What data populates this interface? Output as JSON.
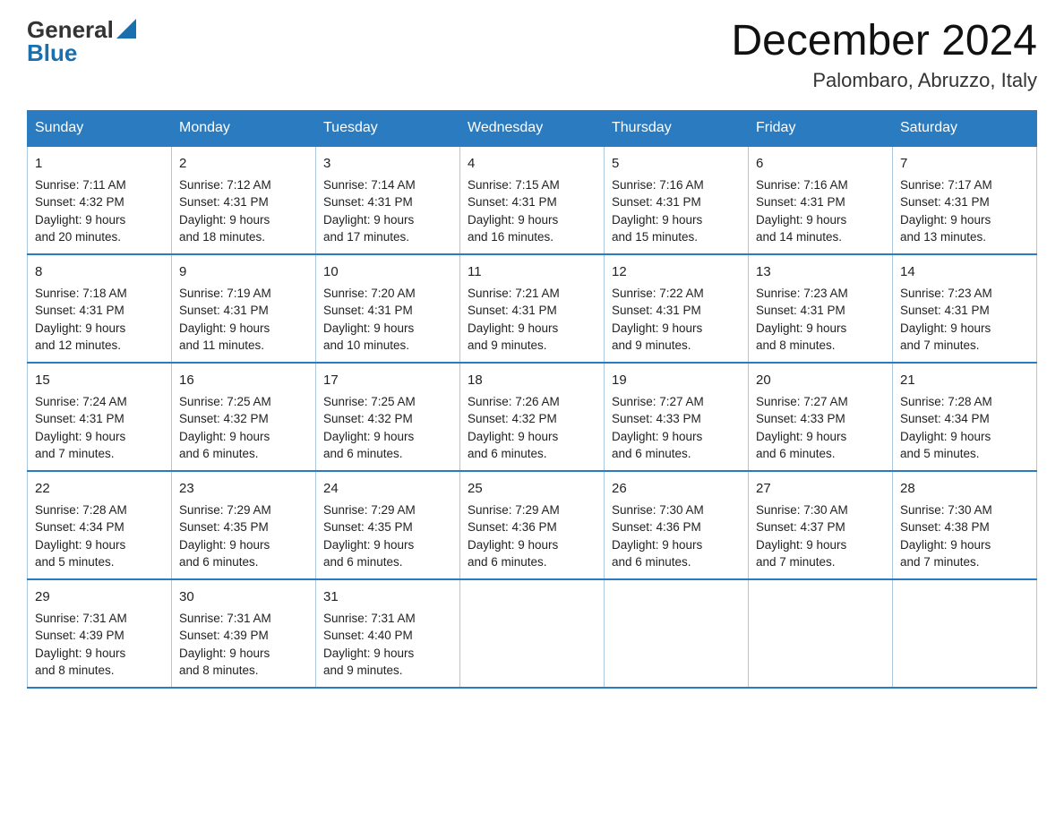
{
  "logo": {
    "general": "General",
    "blue": "Blue",
    "triangle": "▲"
  },
  "title": {
    "month": "December 2024",
    "location": "Palombaro, Abruzzo, Italy"
  },
  "headers": [
    "Sunday",
    "Monday",
    "Tuesday",
    "Wednesday",
    "Thursday",
    "Friday",
    "Saturday"
  ],
  "weeks": [
    [
      {
        "day": "1",
        "info": "Sunrise: 7:11 AM\nSunset: 4:32 PM\nDaylight: 9 hours\nand 20 minutes."
      },
      {
        "day": "2",
        "info": "Sunrise: 7:12 AM\nSunset: 4:31 PM\nDaylight: 9 hours\nand 18 minutes."
      },
      {
        "day": "3",
        "info": "Sunrise: 7:14 AM\nSunset: 4:31 PM\nDaylight: 9 hours\nand 17 minutes."
      },
      {
        "day": "4",
        "info": "Sunrise: 7:15 AM\nSunset: 4:31 PM\nDaylight: 9 hours\nand 16 minutes."
      },
      {
        "day": "5",
        "info": "Sunrise: 7:16 AM\nSunset: 4:31 PM\nDaylight: 9 hours\nand 15 minutes."
      },
      {
        "day": "6",
        "info": "Sunrise: 7:16 AM\nSunset: 4:31 PM\nDaylight: 9 hours\nand 14 minutes."
      },
      {
        "day": "7",
        "info": "Sunrise: 7:17 AM\nSunset: 4:31 PM\nDaylight: 9 hours\nand 13 minutes."
      }
    ],
    [
      {
        "day": "8",
        "info": "Sunrise: 7:18 AM\nSunset: 4:31 PM\nDaylight: 9 hours\nand 12 minutes."
      },
      {
        "day": "9",
        "info": "Sunrise: 7:19 AM\nSunset: 4:31 PM\nDaylight: 9 hours\nand 11 minutes."
      },
      {
        "day": "10",
        "info": "Sunrise: 7:20 AM\nSunset: 4:31 PM\nDaylight: 9 hours\nand 10 minutes."
      },
      {
        "day": "11",
        "info": "Sunrise: 7:21 AM\nSunset: 4:31 PM\nDaylight: 9 hours\nand 9 minutes."
      },
      {
        "day": "12",
        "info": "Sunrise: 7:22 AM\nSunset: 4:31 PM\nDaylight: 9 hours\nand 9 minutes."
      },
      {
        "day": "13",
        "info": "Sunrise: 7:23 AM\nSunset: 4:31 PM\nDaylight: 9 hours\nand 8 minutes."
      },
      {
        "day": "14",
        "info": "Sunrise: 7:23 AM\nSunset: 4:31 PM\nDaylight: 9 hours\nand 7 minutes."
      }
    ],
    [
      {
        "day": "15",
        "info": "Sunrise: 7:24 AM\nSunset: 4:31 PM\nDaylight: 9 hours\nand 7 minutes."
      },
      {
        "day": "16",
        "info": "Sunrise: 7:25 AM\nSunset: 4:32 PM\nDaylight: 9 hours\nand 6 minutes."
      },
      {
        "day": "17",
        "info": "Sunrise: 7:25 AM\nSunset: 4:32 PM\nDaylight: 9 hours\nand 6 minutes."
      },
      {
        "day": "18",
        "info": "Sunrise: 7:26 AM\nSunset: 4:32 PM\nDaylight: 9 hours\nand 6 minutes."
      },
      {
        "day": "19",
        "info": "Sunrise: 7:27 AM\nSunset: 4:33 PM\nDaylight: 9 hours\nand 6 minutes."
      },
      {
        "day": "20",
        "info": "Sunrise: 7:27 AM\nSunset: 4:33 PM\nDaylight: 9 hours\nand 6 minutes."
      },
      {
        "day": "21",
        "info": "Sunrise: 7:28 AM\nSunset: 4:34 PM\nDaylight: 9 hours\nand 5 minutes."
      }
    ],
    [
      {
        "day": "22",
        "info": "Sunrise: 7:28 AM\nSunset: 4:34 PM\nDaylight: 9 hours\nand 5 minutes."
      },
      {
        "day": "23",
        "info": "Sunrise: 7:29 AM\nSunset: 4:35 PM\nDaylight: 9 hours\nand 6 minutes."
      },
      {
        "day": "24",
        "info": "Sunrise: 7:29 AM\nSunset: 4:35 PM\nDaylight: 9 hours\nand 6 minutes."
      },
      {
        "day": "25",
        "info": "Sunrise: 7:29 AM\nSunset: 4:36 PM\nDaylight: 9 hours\nand 6 minutes."
      },
      {
        "day": "26",
        "info": "Sunrise: 7:30 AM\nSunset: 4:36 PM\nDaylight: 9 hours\nand 6 minutes."
      },
      {
        "day": "27",
        "info": "Sunrise: 7:30 AM\nSunset: 4:37 PM\nDaylight: 9 hours\nand 7 minutes."
      },
      {
        "day": "28",
        "info": "Sunrise: 7:30 AM\nSunset: 4:38 PM\nDaylight: 9 hours\nand 7 minutes."
      }
    ],
    [
      {
        "day": "29",
        "info": "Sunrise: 7:31 AM\nSunset: 4:39 PM\nDaylight: 9 hours\nand 8 minutes."
      },
      {
        "day": "30",
        "info": "Sunrise: 7:31 AM\nSunset: 4:39 PM\nDaylight: 9 hours\nand 8 minutes."
      },
      {
        "day": "31",
        "info": "Sunrise: 7:31 AM\nSunset: 4:40 PM\nDaylight: 9 hours\nand 9 minutes."
      },
      {
        "day": "",
        "info": ""
      },
      {
        "day": "",
        "info": ""
      },
      {
        "day": "",
        "info": ""
      },
      {
        "day": "",
        "info": ""
      }
    ]
  ]
}
